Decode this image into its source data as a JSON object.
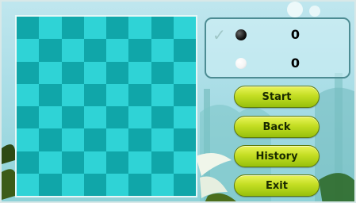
{
  "board": {
    "size": 8,
    "dark_color": "#10a6a9",
    "light_color": "#2fd3d6"
  },
  "scores": {
    "black": "0",
    "white": "0"
  },
  "buttons": {
    "start": "Start",
    "back": "Back",
    "history": "History",
    "exit": "Exit"
  },
  "icons": {
    "turn_indicator": "check-icon",
    "black_stone": "black-stone-icon",
    "white_stone": "white-stone-icon"
  },
  "colors": {
    "button_top": "#e9f45a",
    "button_bottom": "#97c00c",
    "panel_border": "#4d8c93"
  }
}
